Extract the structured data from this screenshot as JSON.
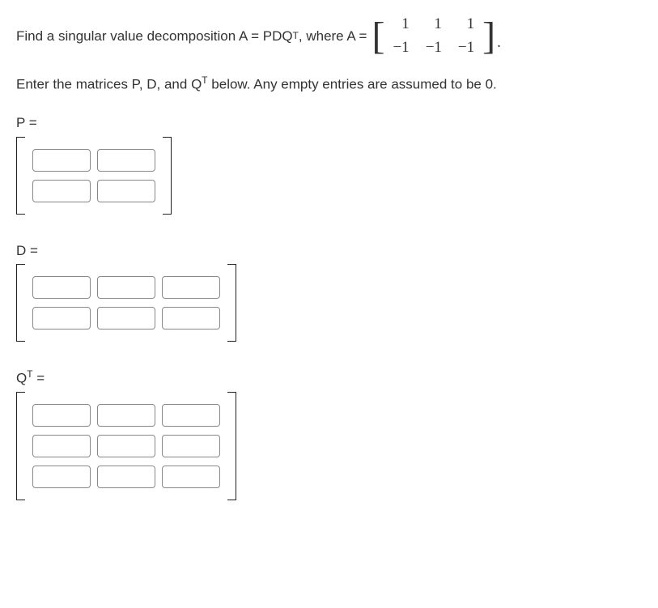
{
  "problem": {
    "text_before": "Find a singular value decomposition A = PDQ",
    "text_after": ", where A = ",
    "matrix_A": {
      "rows": [
        [
          "1",
          "1",
          "1"
        ],
        [
          "−1",
          "−1",
          "−1"
        ]
      ]
    },
    "instruction_a": "Enter the matrices P, D, and Q",
    "instruction_b": " below. Any empty entries are assumed to be 0."
  },
  "matrices": {
    "P": {
      "label": "P =",
      "rows": 2,
      "cols": 2
    },
    "D": {
      "label": "D =",
      "rows": 2,
      "cols": 3
    },
    "QT": {
      "label_a": "Q",
      "label_b": " =",
      "rows": 3,
      "cols": 3
    }
  },
  "superscript": "T"
}
